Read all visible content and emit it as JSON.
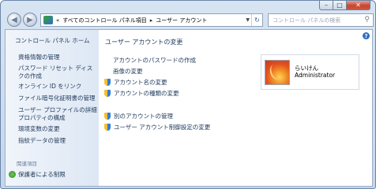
{
  "window": {
    "caption_buttons": {
      "minimize": "–",
      "maximize": "□",
      "close": "✕"
    }
  },
  "nav": {
    "address": {
      "prefix": "«",
      "crumb1": "すべてのコントロール パネル項目",
      "separator": "▸",
      "crumb2": "ユーザー アカウント"
    },
    "search_placeholder": "コントロール パネルの検索"
  },
  "sidebar": {
    "home": "コントロール パネル ホーム",
    "tasks": [
      "資格情報の管理",
      "パスワード リセット ディスクの作成",
      "オンライン ID をリンク",
      "ファイル暗号化証明書の管理",
      "ユーザー プロファイルの詳細プロパティの構成",
      "環境変数の変更",
      "指紋データの管理"
    ],
    "see_also": "関連項目",
    "family_safety": "保護者による制限"
  },
  "main": {
    "heading": "ユーザー アカウントの変更",
    "links": [
      "アカウントのパスワードの作成",
      "画像の変更",
      "アカウント名の変更",
      "アカウントの種類の変更"
    ],
    "links2": [
      "別のアカウントの管理",
      "ユーザー アカウント制御設定の変更"
    ]
  },
  "user": {
    "name": "らいけん",
    "role": "Administrator"
  },
  "colors": {
    "link": "#1e395b",
    "frame": "#c4d6ec"
  },
  "icons": {
    "help": "?"
  }
}
